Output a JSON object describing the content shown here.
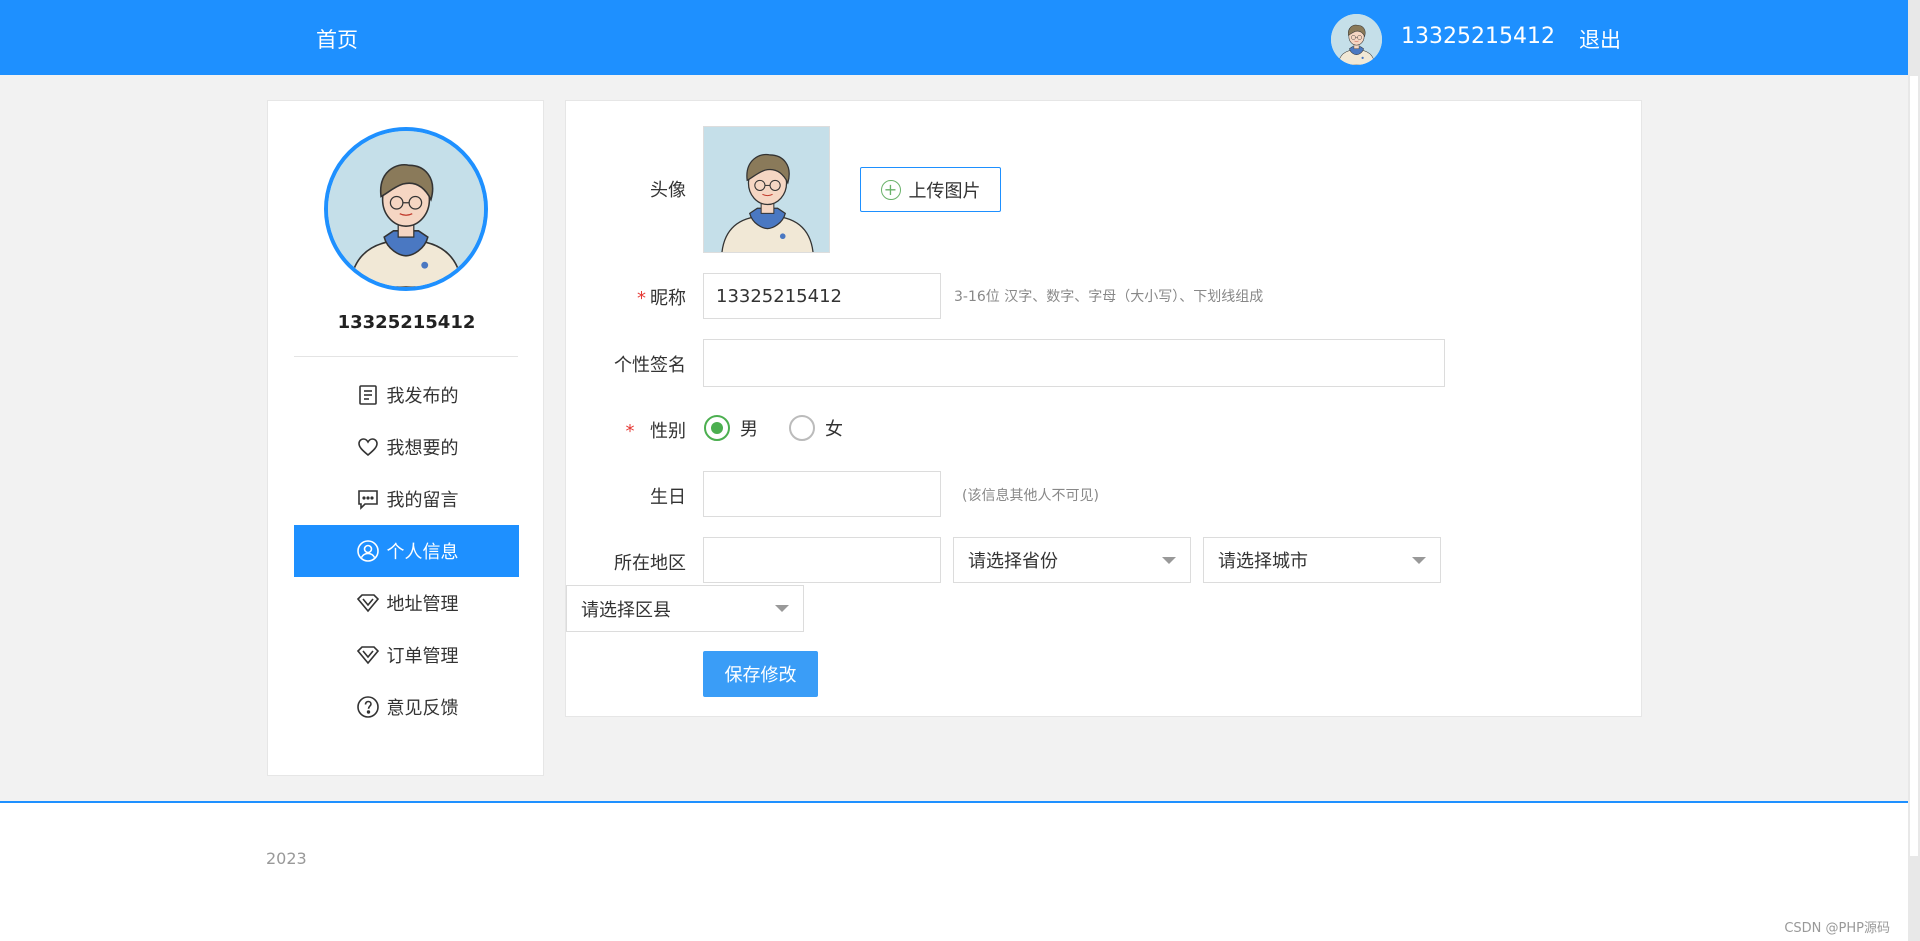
{
  "header": {
    "home_label": "首页",
    "username": "13325215412",
    "logout_label": "退出"
  },
  "sidebar": {
    "username": "13325215412",
    "items": [
      {
        "label": "我发布的",
        "icon": "document-icon",
        "active": false
      },
      {
        "label": "我想要的",
        "icon": "heart-icon",
        "active": false
      },
      {
        "label": "我的留言",
        "icon": "message-icon",
        "active": false
      },
      {
        "label": "个人信息",
        "icon": "user-icon",
        "active": true
      },
      {
        "label": "地址管理",
        "icon": "diamond-icon",
        "active": false
      },
      {
        "label": "订单管理",
        "icon": "diamond-icon",
        "active": false
      },
      {
        "label": "意见反馈",
        "icon": "question-icon",
        "active": false
      }
    ]
  },
  "form": {
    "avatar_label": "头像",
    "upload_label": "上传图片",
    "nickname_label": "昵称",
    "nickname_value": "13325215412",
    "nickname_hint": "3-16位 汉字、数字、字母（大小写）、下划线组成",
    "signature_label": "个性签名",
    "signature_value": "",
    "gender_label": "性别",
    "gender_male": "男",
    "gender_female": "女",
    "gender_selected": "男",
    "birthday_label": "生日",
    "birthday_value": "",
    "birthday_hint": "(该信息其他人不可见)",
    "region_label": "所在地区",
    "region_value": "",
    "province_placeholder": "请选择省份",
    "city_placeholder": "请选择城市",
    "district_placeholder": "请选择区县",
    "save_label": "保存修改"
  },
  "footer": {
    "year": "2023",
    "watermark": "CSDN @PHP源码"
  },
  "colors": {
    "primary": "#1e90ff",
    "radio_checked": "#4caf50",
    "required": "#e53935"
  }
}
